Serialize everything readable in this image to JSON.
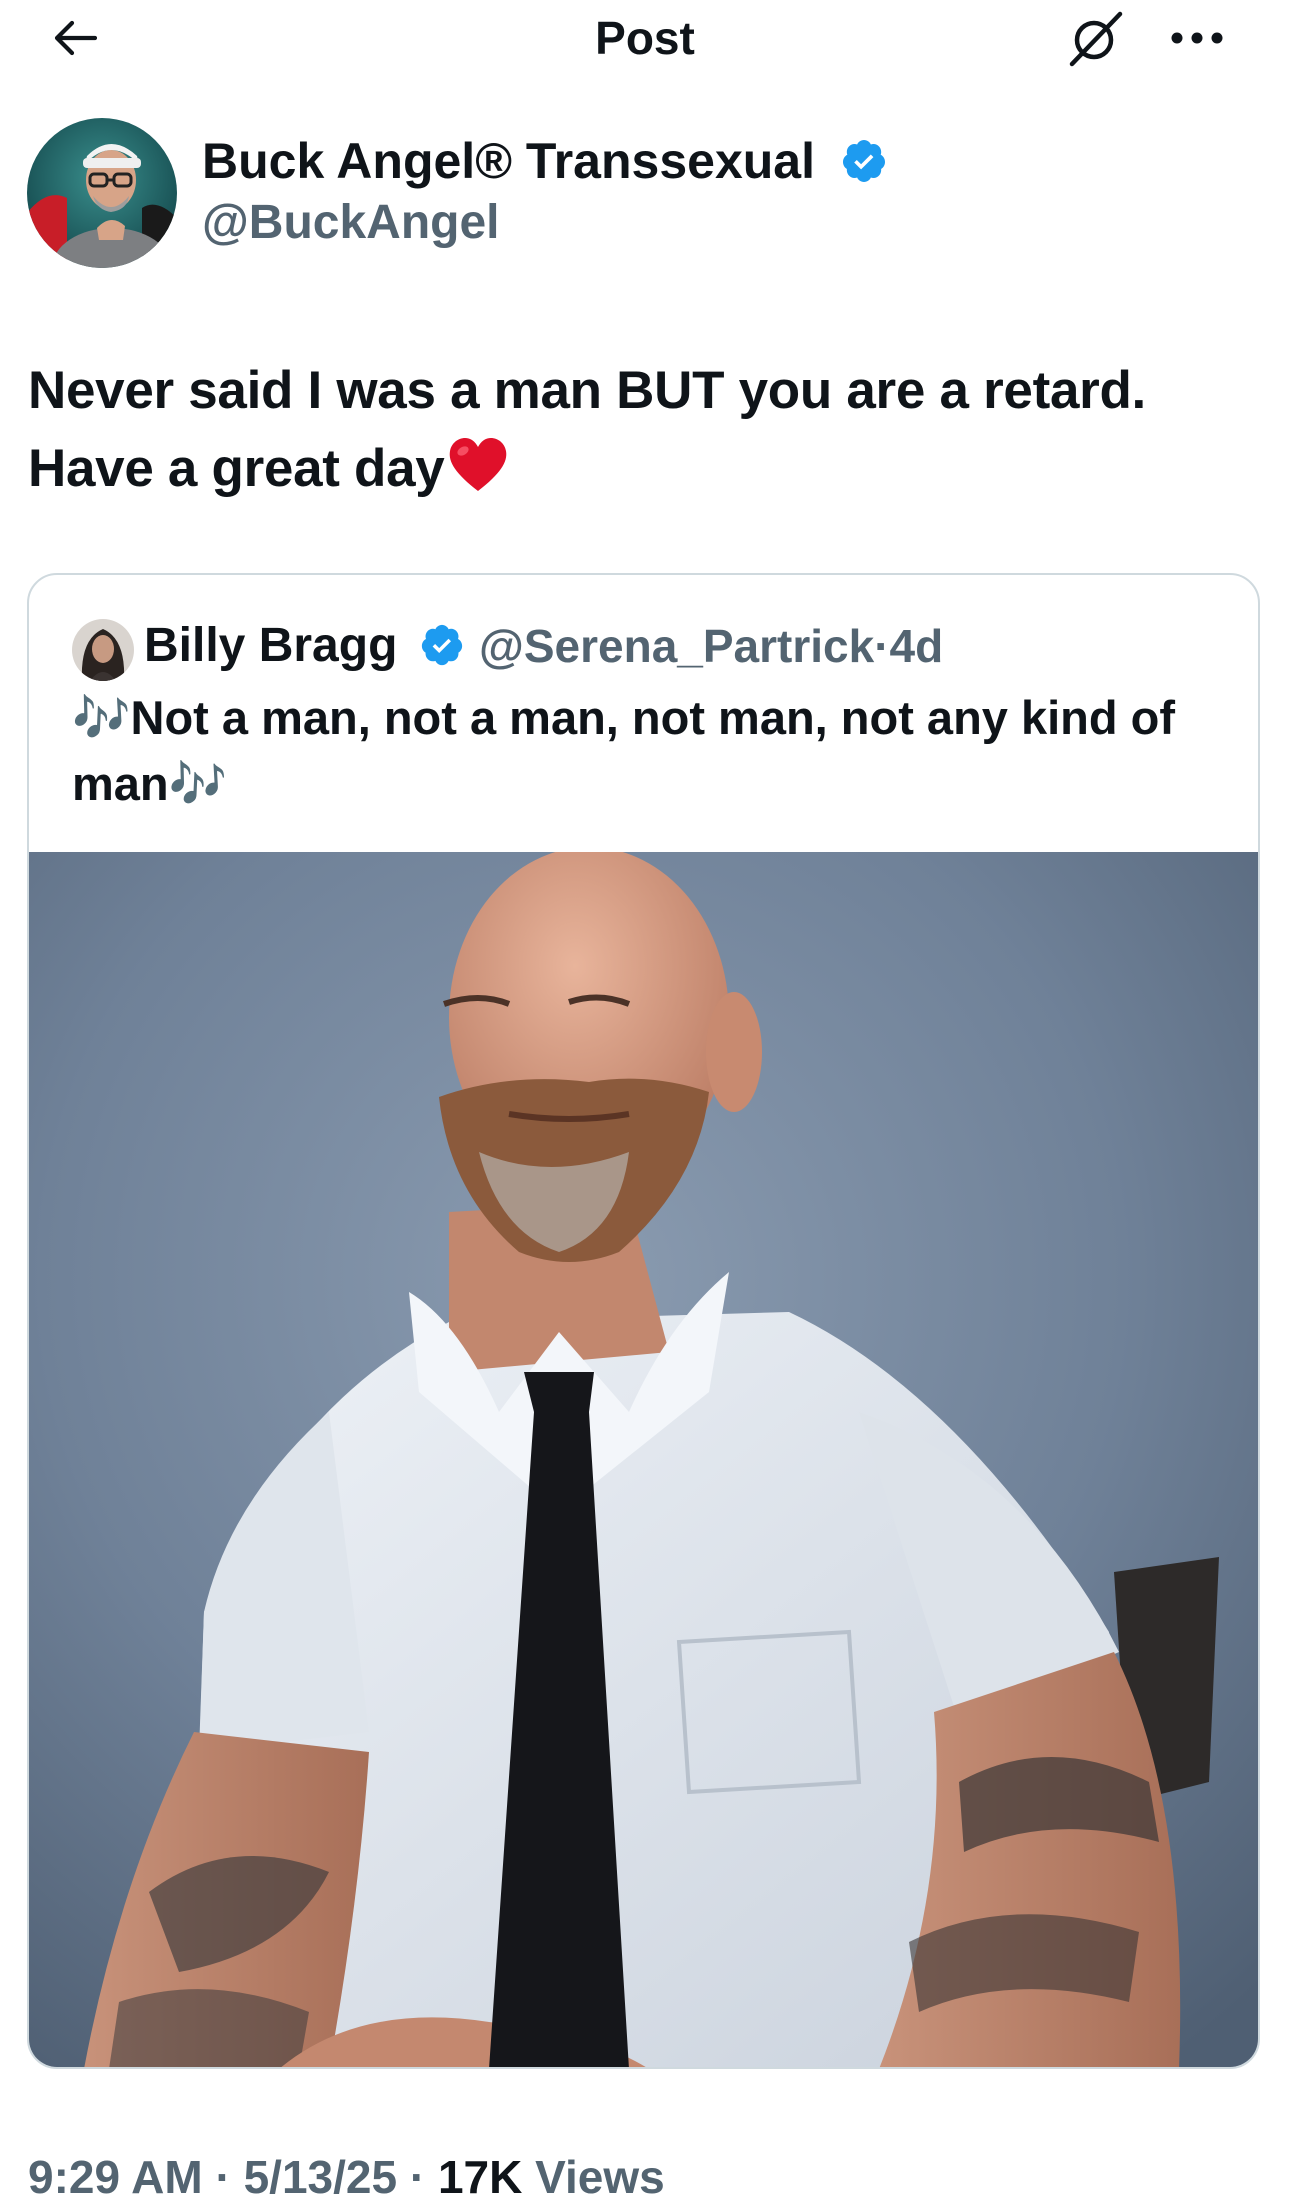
{
  "header": {
    "title": "Post"
  },
  "post": {
    "author": {
      "display_name": "Buck Angel® Transsexual",
      "handle": "@BuckAngel",
      "verified": true
    },
    "text_line1": "Never said I was a man BUT you are a retard.",
    "text_line2": "Have a great day",
    "emoji": "red-heart",
    "quoted": {
      "display_name": "Billy Bragg",
      "handle": "@Serena_Partrick",
      "separator": "·",
      "age": "4d",
      "verified": true,
      "text": "🎶Not a man, not a man, not man, not any kind of man🎶",
      "media": "photo"
    },
    "meta": {
      "time": "9:29 AM",
      "date": "5/13/25",
      "views": "17K",
      "views_label": "Views"
    }
  },
  "colors": {
    "text": "#0f1419",
    "secondary": "#536471",
    "verified_blue": "#1d9bf0",
    "border": "#cfd9de",
    "heart": "#e0102a"
  },
  "icons": [
    "back-arrow-icon",
    "grok-icon",
    "more-icon",
    "verified-badge-icon",
    "heart-emoji",
    "music-notes-emoji"
  ]
}
